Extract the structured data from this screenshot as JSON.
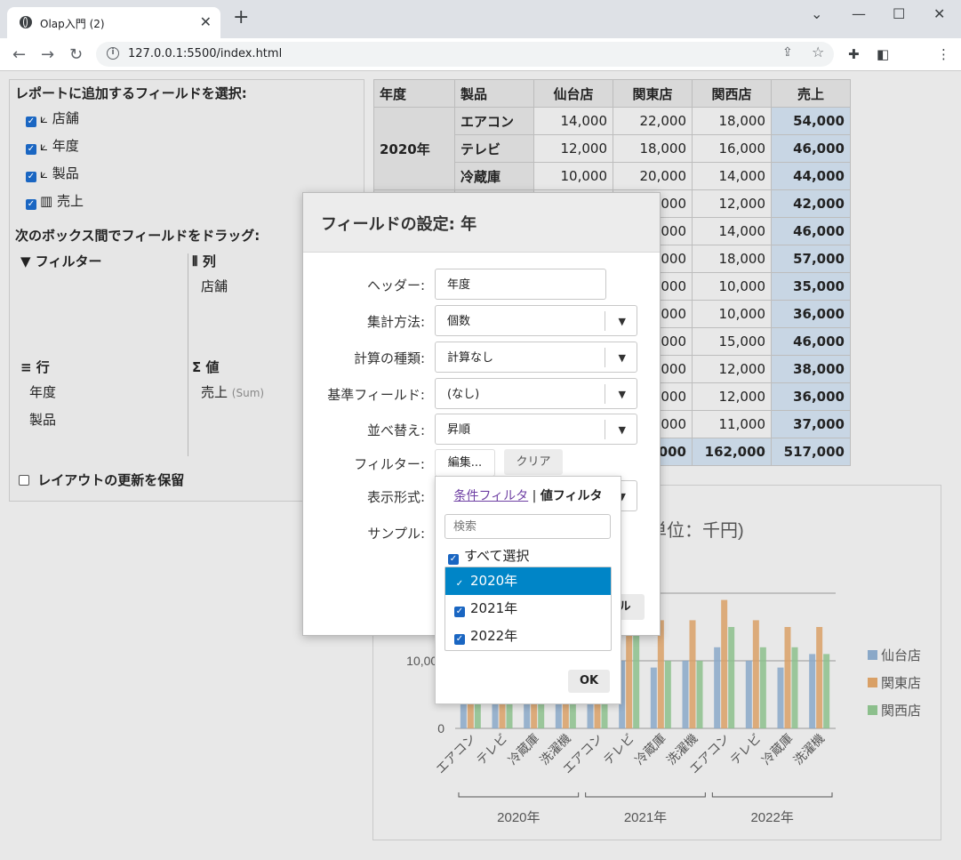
{
  "browser": {
    "tab_title": "Olap入門 (2)",
    "url": "127.0.0.1:5500/index.html"
  },
  "field_panel": {
    "title": "レポートに追加するフィールドを選択:",
    "fields": [
      {
        "label": "⟀ 店舗",
        "checked": true
      },
      {
        "label": "⟀ 年度",
        "checked": true
      },
      {
        "label": "⟀ 製品",
        "checked": true
      },
      {
        "label": "▥ 売上",
        "checked": true
      }
    ],
    "drag_title": "次のボックス間でフィールドをドラッグ:",
    "filter_label": "フィルター",
    "columns_label": "列",
    "columns_items": [
      "店舗"
    ],
    "rows_label": "行",
    "rows_items": [
      "年度",
      "製品"
    ],
    "values_label": "値",
    "values_item": "売上",
    "values_agg": "(Sum)",
    "defer_label": "レイアウトの更新を保留"
  },
  "pivot": {
    "headers": [
      "年度",
      "製品",
      "仙台店",
      "関東店",
      "関西店",
      "売上"
    ],
    "year_2020": "2020年",
    "rows": [
      {
        "product": "エアコン",
        "v1": "14,000",
        "v2": "22,000",
        "v3": "18,000",
        "total": "54,000"
      },
      {
        "product": "テレビ",
        "v1": "12,000",
        "v2": "18,000",
        "v3": "16,000",
        "total": "46,000"
      },
      {
        "product": "冷蔵庫",
        "v1": "10,000",
        "v2": "20,000",
        "v3": "14,000",
        "total": "44,000"
      },
      {
        "product": "",
        "v1": "",
        "v2": "000",
        "v3": "12,000",
        "total": "42,000"
      },
      {
        "product": "",
        "v1": "",
        "v2": "000",
        "v3": "14,000",
        "total": "46,000"
      },
      {
        "product": "",
        "v1": "",
        "v2": "000",
        "v3": "18,000",
        "total": "57,000"
      },
      {
        "product": "",
        "v1": "",
        "v2": "000",
        "v3": "10,000",
        "total": "35,000"
      },
      {
        "product": "",
        "v1": "",
        "v2": "000",
        "v3": "10,000",
        "total": "36,000"
      },
      {
        "product": "",
        "v1": "",
        "v2": "000",
        "v3": "15,000",
        "total": "46,000"
      },
      {
        "product": "",
        "v1": "",
        "v2": "000",
        "v3": "12,000",
        "total": "38,000"
      },
      {
        "product": "",
        "v1": "",
        "v2": "000",
        "v3": "12,000",
        "total": "36,000"
      },
      {
        "product": "",
        "v1": "",
        "v2": "000",
        "v3": "11,000",
        "total": "37,000"
      }
    ],
    "grand": {
      "v2": "000",
      "v3": "162,000",
      "total": "517,000"
    }
  },
  "chart_data": {
    "type": "bar",
    "title_visible": "単位：千円)",
    "groups": [
      "2020年",
      "2021年",
      "2022年"
    ],
    "categories": [
      "エアコン",
      "テレビ",
      "冷蔵庫",
      "洗濯機",
      "エアコン",
      "テレビ",
      "冷蔵庫",
      "洗濯機",
      "エアコン",
      "テレビ",
      "冷蔵庫",
      "洗濯機"
    ],
    "series": [
      {
        "name": "仙台店",
        "color": "#8aa8c8",
        "values": [
          14000,
          12000,
          10000,
          11000,
          13000,
          10000,
          9000,
          10000,
          12000,
          10000,
          9000,
          11000
        ]
      },
      {
        "name": "関東店",
        "color": "#d9a066",
        "values": [
          22000,
          18000,
          20000,
          16000,
          18000,
          17000,
          16000,
          16000,
          19000,
          16000,
          15000,
          15000
        ]
      },
      {
        "name": "関西店",
        "color": "#8cbf8c",
        "values": [
          18000,
          16000,
          14000,
          12000,
          14000,
          18000,
          10000,
          10000,
          15000,
          12000,
          12000,
          11000
        ]
      }
    ],
    "y_ticks": [
      "0",
      "10,000"
    ],
    "ylim": [
      0,
      20000
    ]
  },
  "dialog": {
    "title": "フィールドの設定: 年",
    "header_label": "ヘッダー:",
    "header_value": "年度",
    "agg_label": "集計方法:",
    "agg_value": "個数",
    "calc_label": "計算の種類:",
    "calc_value": "計算なし",
    "base_label": "基準フィールド:",
    "base_value": "(なし)",
    "sort_label": "並べ替え:",
    "sort_value": "昇順",
    "filter_label": "フィルター:",
    "edit_button": "編集...",
    "clear_button": "クリア",
    "format_label": "表示形式:",
    "sample_label": "サンプル:",
    "cancel_partial": "ル"
  },
  "filter_popup": {
    "tab_condition": "条件フィルタ",
    "tab_value": "値フィルタ",
    "search_placeholder": "検索",
    "select_all": "すべて選択",
    "items": [
      "2020年",
      "2021年",
      "2022年"
    ],
    "ok": "OK"
  }
}
